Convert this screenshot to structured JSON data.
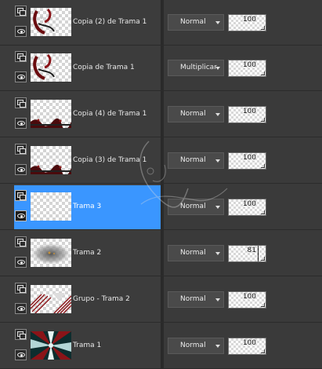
{
  "colors": {
    "background": "#3a3a3a",
    "selected_row": "#3a96ff",
    "divider": "#2a2a2a"
  },
  "layers_panel": {
    "layers": [
      {
        "name": "Copia (2) de Trama 1",
        "blend_mode": "Normal",
        "opacity": "100",
        "thumbnail": "red-swirl-fragment",
        "selected": false
      },
      {
        "name": "Copia de Trama 1",
        "blend_mode": "Multiplicar",
        "opacity": "100",
        "thumbnail": "red-swirl-fragment",
        "selected": false
      },
      {
        "name": "Copia (4) de Trama 1",
        "blend_mode": "Normal",
        "opacity": "100",
        "thumbnail": "dark-red-bottom-strip",
        "selected": false
      },
      {
        "name": "Copia (3) de Trama 1",
        "blend_mode": "Normal",
        "opacity": "100",
        "thumbnail": "dark-red-bottom-strip",
        "selected": false
      },
      {
        "name": "Trama 3",
        "blend_mode": "Normal",
        "opacity": "100",
        "thumbnail": "empty-transparent",
        "selected": true
      },
      {
        "name": "Trama 2",
        "blend_mode": "Normal",
        "opacity": "81",
        "thumbnail": "grey-blur",
        "selected": false
      },
      {
        "name": "Grupo - Trama 2",
        "blend_mode": "Normal",
        "opacity": "100",
        "thumbnail": "red-diagonal-stripes",
        "selected": false
      },
      {
        "name": "Trama 1",
        "blend_mode": "Normal",
        "opacity": "100",
        "thumbnail": "teal-red-starburst",
        "selected": false
      }
    ]
  }
}
